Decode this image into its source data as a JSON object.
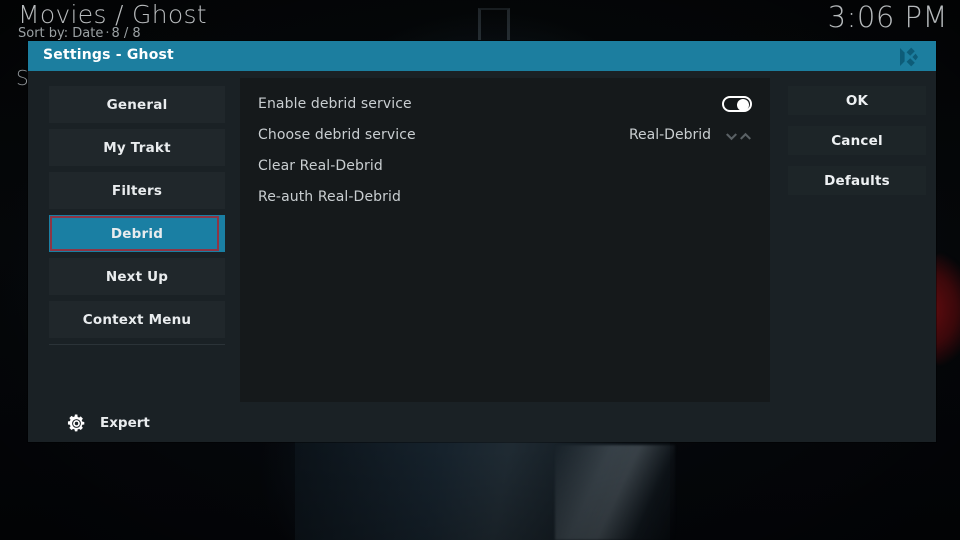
{
  "background": {
    "header_title": "Movies / Ghost",
    "sort_label": "Sort by: Date",
    "sort_separator": "·",
    "item_count": "8 / 8",
    "clock": "3:06 PM",
    "obscured_text": "S",
    "accent_color": "#1c7e9f",
    "red_arc_color": "#961216"
  },
  "dialog": {
    "title": "Settings - Ghost",
    "logo_icon": "kodi-logo-icon",
    "titlebar_color": "#1c7e9f",
    "body_color": "#1a2125",
    "content_color": "#15191b",
    "selected_color": "#1a7fa3",
    "focus_border_color": "#8e3545"
  },
  "sidebar": {
    "items": [
      {
        "label": "General",
        "selected": false
      },
      {
        "label": "My Trakt",
        "selected": false
      },
      {
        "label": "Filters",
        "selected": false
      },
      {
        "label": "Debrid",
        "selected": true
      },
      {
        "label": "Next Up",
        "selected": false
      },
      {
        "label": "Context Menu",
        "selected": false
      }
    ],
    "expert": {
      "label": "Expert",
      "icon": "gear-icon"
    }
  },
  "settings": {
    "rows": [
      {
        "label": "Enable debrid service",
        "control": "toggle",
        "value": "on"
      },
      {
        "label": "Choose debrid service",
        "control": "spinner",
        "value": "Real-Debrid",
        "down_icon": "chevron-down-icon",
        "up_icon": "chevron-up-icon"
      },
      {
        "label": "Clear Real-Debrid",
        "control": "action",
        "value": ""
      },
      {
        "label": "Re-auth Real-Debrid",
        "control": "action",
        "value": ""
      }
    ]
  },
  "buttons": {
    "ok": "OK",
    "cancel": "Cancel",
    "defaults": "Defaults"
  }
}
